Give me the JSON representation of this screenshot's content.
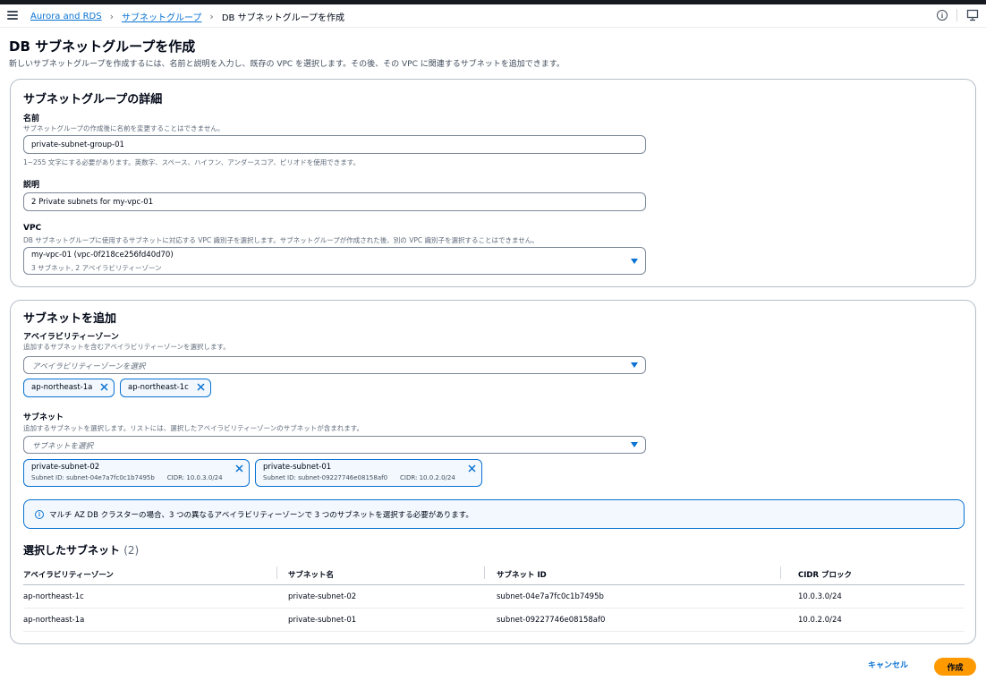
{
  "breadcrumb": {
    "item1": "Aurora and RDS",
    "item2": "サブネットグループ",
    "current": "DB サブネットグループを作成"
  },
  "page": {
    "title": "DB サブネットグループを作成",
    "description": "新しいサブネットグループを作成するには、名前と説明を入力し、既存の VPC を選択します。その後、その VPC に関連するサブネットを追加できます。"
  },
  "details": {
    "title": "サブネットグループの詳細",
    "name_label": "名前",
    "name_desc": "サブネットグループの作成後に名前を変更することはできません。",
    "name_value": "private-subnet-group-01",
    "name_constraint": "1~255 文字にする必要があります。英数字、スペース、ハイフン、アンダースコア、ピリオドを使用できます。",
    "desc_label": "説明",
    "desc_value": "2 Private subnets for my-vpc-01",
    "vpc_label": "VPC",
    "vpc_desc": "DB サブネットグループに使用するサブネットに対応する VPC 識別子を選択します。サブネットグループが作成された後、別の VPC 識別子を選択することはできません。",
    "vpc_value": "my-vpc-01 (vpc-0f218ce256fd40d70)",
    "vpc_sub": "3 サブネット, 2 アベイラビリティーゾーン"
  },
  "add_subnets": {
    "title": "サブネットを追加",
    "az_label": "アベイラビリティーゾーン",
    "az_desc": "追加するサブネットを含むアベイラビリティーゾーンを選択します。",
    "az_placeholder": "アベイラビリティーゾーンを選択",
    "az_tokens": [
      "ap-northeast-1a",
      "ap-northeast-1c"
    ],
    "subnet_label": "サブネット",
    "subnet_desc": "追加するサブネットを選択します。リストには、選択したアベイラビリティーゾーンのサブネットが含まれます。",
    "subnet_placeholder": "サブネットを選択",
    "subnet_tokens": [
      {
        "name": "private-subnet-02",
        "id": "Subnet ID: subnet-04e7a7fc0c1b7495b",
        "cidr": "CIDR: 10.0.3.0/24"
      },
      {
        "name": "private-subnet-01",
        "id": "Subnet ID: subnet-09227746e08158af0",
        "cidr": "CIDR: 10.0.2.0/24"
      }
    ],
    "alert": "マルチ AZ DB クラスターの場合、3 つの異なるアベイラビリティーゾーンで 3 つのサブネットを選択する必要があります。",
    "selected_title": "選択したサブネット",
    "selected_count": "(2)",
    "columns": [
      "アベイラビリティーゾーン",
      "サブネット名",
      "サブネット ID",
      "CIDR ブロック"
    ],
    "rows": [
      [
        "ap-northeast-1c",
        "private-subnet-02",
        "subnet-04e7a7fc0c1b7495b",
        "10.0.3.0/24"
      ],
      [
        "ap-northeast-1a",
        "private-subnet-01",
        "subnet-09227746e08158af0",
        "10.0.2.0/24"
      ]
    ]
  },
  "actions": {
    "cancel": "キャンセル",
    "create": "作成"
  },
  "colors": {
    "link": "#0972d3",
    "primary_button": "#ff9900"
  }
}
